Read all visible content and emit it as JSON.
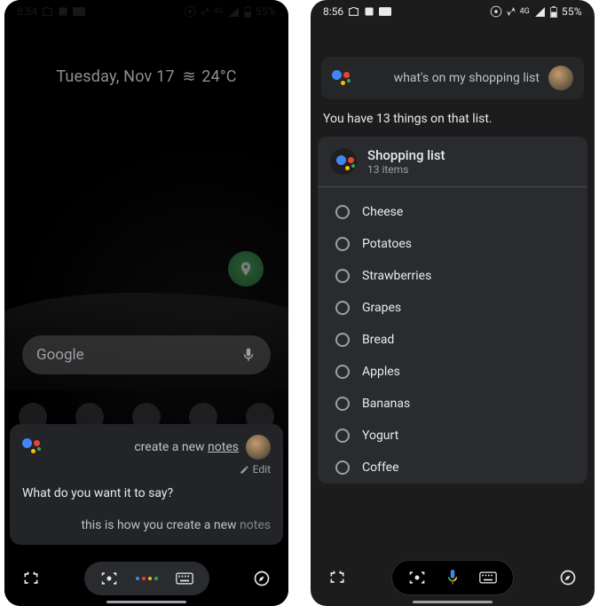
{
  "left": {
    "status": {
      "time": "8:54",
      "battery": "55%"
    },
    "home": {
      "date": "Tuesday, Nov 17",
      "temp": "24°C",
      "search_placeholder": "Google"
    },
    "assistant": {
      "query_prefix": "create a new ",
      "query_underlined": "notes",
      "edit_label": "Edit",
      "prompt": "What do you want it to say?",
      "response_prefix": "this is how you create a new ",
      "response_dim": "notes"
    }
  },
  "right": {
    "status": {
      "time": "8:56",
      "battery": "55%"
    },
    "query": "what's on my shopping list",
    "summary": "You have 13 things on that list.",
    "list": {
      "title": "Shopping list",
      "subtitle": "13 items",
      "items": [
        "Cheese",
        "Potatoes",
        "Strawberries",
        "Grapes",
        "Bread",
        "Apples",
        "Bananas",
        "Yogurt",
        "Coffee"
      ]
    }
  }
}
